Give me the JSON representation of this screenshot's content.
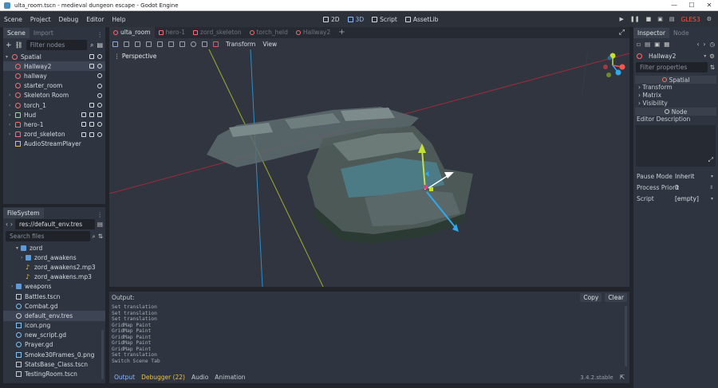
{
  "window": {
    "title": "ulta_room.tscn - medieval dungeon escape - Godot Engine",
    "buttons": [
      "—",
      "☐",
      "✕"
    ]
  },
  "menu": [
    "Scene",
    "Project",
    "Debug",
    "Editor",
    "Help"
  ],
  "workspaces": [
    {
      "label": "2D",
      "active": false
    },
    {
      "label": "3D",
      "active": true
    },
    {
      "label": "Script",
      "active": false
    },
    {
      "label": "AssetLib",
      "active": false
    }
  ],
  "playbar": {
    "renderer": "GLES3"
  },
  "scene_dock": {
    "tabs": [
      "Scene",
      "Import"
    ],
    "filter_placeholder": "Filter nodes",
    "root": "Spatial",
    "nodes": [
      {
        "label": "Hallway2",
        "icon": "spatial-icon",
        "selected": true
      },
      {
        "label": "hallway",
        "icon": "spatial-icon"
      },
      {
        "label": "starter_room",
        "icon": "spatial-icon"
      },
      {
        "label": "Skeleton Room",
        "icon": "spatial-icon",
        "expand": true
      },
      {
        "label": "torch_1",
        "icon": "spatial-icon",
        "expand": true
      },
      {
        "label": "Hud",
        "icon": "hud-icon",
        "expand": true
      },
      {
        "label": "hero-1",
        "icon": "character-icon",
        "expand": true
      },
      {
        "label": "zord_skeleton",
        "icon": "character-icon",
        "expand": true
      },
      {
        "label": "AudioStreamPlayer",
        "icon": "audio-icon"
      }
    ]
  },
  "filesystem": {
    "tab": "FileSystem",
    "path": "res://default_env.tres",
    "search_placeholder": "Search files",
    "items": [
      {
        "label": "zord",
        "type": "folder",
        "indent": 2
      },
      {
        "label": "zord_awakens",
        "type": "folder",
        "indent": 3
      },
      {
        "label": "zord_awakens2.mp3",
        "type": "music",
        "indent": 3
      },
      {
        "label": "zord_awakens.mp3",
        "type": "music",
        "indent": 3
      },
      {
        "label": "weapons",
        "type": "folder",
        "indent": 1
      },
      {
        "label": "Battles.tscn",
        "type": "scene",
        "indent": 1
      },
      {
        "label": "Combat.gd",
        "type": "gd",
        "indent": 1
      },
      {
        "label": "default_env.tres",
        "type": "res",
        "indent": 1,
        "selected": true
      },
      {
        "label": "icon.png",
        "type": "img",
        "indent": 1
      },
      {
        "label": "new_script.gd",
        "type": "gd",
        "indent": 1
      },
      {
        "label": "Prayer.gd",
        "type": "gd",
        "indent": 1
      },
      {
        "label": "Smoke30Frames_0.png",
        "type": "img",
        "indent": 1
      },
      {
        "label": "StatsBase_Class.tscn",
        "type": "scene",
        "indent": 1
      },
      {
        "label": "TestingRoom.tscn",
        "type": "scene",
        "indent": 1
      }
    ]
  },
  "scene_tabs": [
    {
      "label": "ulta_room",
      "active": true
    },
    {
      "label": "hero-1"
    },
    {
      "label": "zord_skeleton"
    },
    {
      "label": "torch_held"
    },
    {
      "label": "Hallway2"
    }
  ],
  "viewport_toolbar": {
    "transform": "Transform",
    "view": "View"
  },
  "viewport": {
    "mode": "Perspective"
  },
  "output": {
    "title": "Output:",
    "copy": "Copy",
    "clear": "Clear",
    "lines": "Set translation\nSet translation\nSet translation\nGridMap Paint\nGridMap Paint\nGridMap Paint\nGridMap Paint\nGridMap Paint\nSet translation\nSwitch Scene Tab",
    "bottom_tabs": [
      "Output",
      "Debugger (22)",
      "Audio",
      "Animation"
    ],
    "version": "3.4.2.stable"
  },
  "inspector": {
    "tabs": [
      "Inspector",
      "Node"
    ],
    "node": "Hallway2",
    "filter_placeholder": "Filter properties",
    "class_header": "Spatial",
    "sections": [
      "Transform",
      "Matrix",
      "Visibility"
    ],
    "node_header": "Node",
    "editor_description": "Editor Description",
    "props": [
      {
        "name": "Pause Mode",
        "value": "Inherit"
      },
      {
        "name": "Process Priorit",
        "value": "0"
      },
      {
        "name": "Script",
        "value": "[empty]"
      }
    ]
  },
  "colors": {
    "accent": "#478cbf",
    "x_axis": "#f4574e",
    "y_axis": "#c4e034",
    "z_axis": "#3ea8f0"
  }
}
